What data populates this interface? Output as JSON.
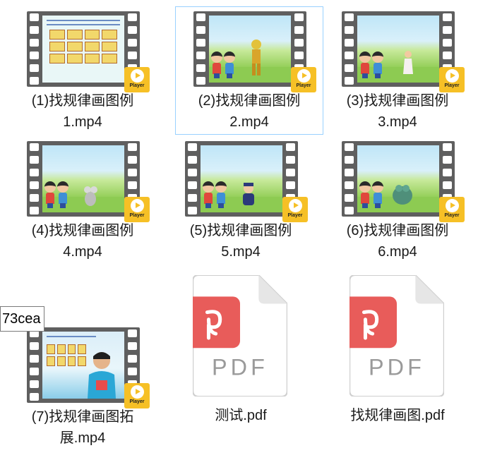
{
  "files": [
    {
      "name_line1": "(1)找规律画图例",
      "name_line2": "1.mp4",
      "type": "video",
      "badge": "Player"
    },
    {
      "name_line1": "(2)找规律画图例",
      "name_line2": "2.mp4",
      "type": "video",
      "badge": "Player",
      "selected": true
    },
    {
      "name_line1": "(3)找规律画图例",
      "name_line2": "3.mp4",
      "type": "video",
      "badge": "Player"
    },
    {
      "name_line1": "(4)找规律画图例",
      "name_line2": "4.mp4",
      "type": "video",
      "badge": "Player"
    },
    {
      "name_line1": "(5)找规律画图例",
      "name_line2": "5.mp4",
      "type": "video",
      "badge": "Player"
    },
    {
      "name_line1": "(6)找规律画图例",
      "name_line2": "6.mp4",
      "type": "video",
      "badge": "Player"
    },
    {
      "name_line1": "(7)找规律画图拓",
      "name_line2": "展.mp4",
      "type": "video",
      "badge": "Player"
    },
    {
      "name_line1": "测试.pdf",
      "name_line2": "",
      "type": "pdf",
      "badge_text": "PDF"
    },
    {
      "name_line1": "找规律画图.pdf",
      "name_line2": "",
      "type": "pdf",
      "badge_text": "PDF"
    }
  ],
  "rename_field": {
    "value": "73cea"
  },
  "colors": {
    "accent_selection": "#99d1ff",
    "pdf_red": "#e85c5a",
    "player_yellow": "#f6c026"
  }
}
